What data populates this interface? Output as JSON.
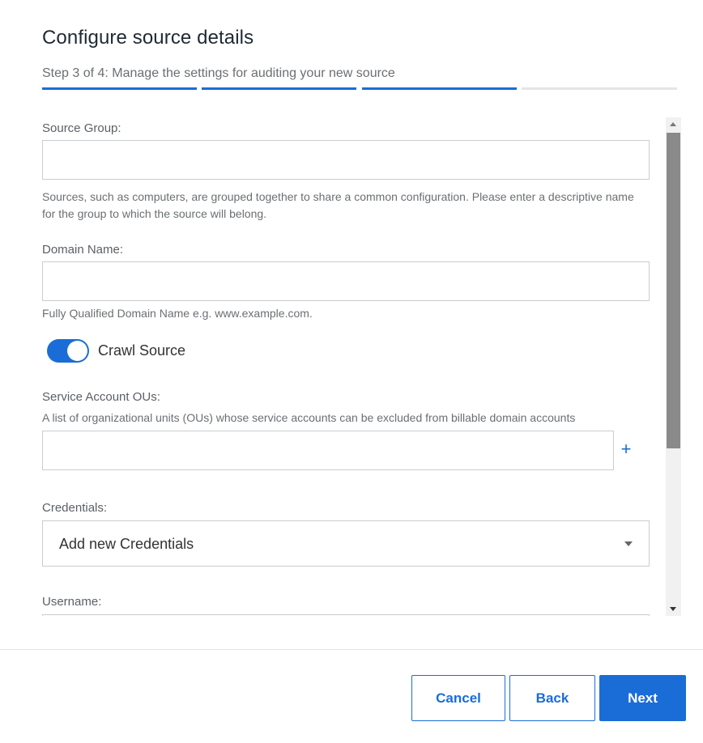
{
  "header": {
    "title": "Configure source details",
    "subtitle": "Step 3 of 4: Manage the settings for auditing your new source",
    "steps_total": 4,
    "steps_completed": 3
  },
  "form": {
    "source_group": {
      "label": "Source Group:",
      "value": "",
      "help": "Sources, such as computers, are grouped together to share a common configuration. Please enter a descriptive name for the group to which the source will belong."
    },
    "domain_name": {
      "label": "Domain Name:",
      "value": "",
      "help": "Fully Qualified Domain Name e.g. www.example.com."
    },
    "crawl_source": {
      "label": "Crawl Source",
      "enabled": true
    },
    "service_account_ous": {
      "label": "Service Account OUs:",
      "help": "A list of organizational units (OUs) whose service accounts can be excluded from billable domain accounts",
      "value": "",
      "add_icon": "plus-icon"
    },
    "credentials": {
      "label": "Credentials:",
      "selected": "Add new Credentials"
    },
    "username": {
      "label": "Username:",
      "value": ""
    }
  },
  "footer": {
    "cancel_label": "Cancel",
    "back_label": "Back",
    "next_label": "Next"
  },
  "colors": {
    "accent": "#1a6dd6",
    "step_inactive": "#e3e5e8",
    "scroll_thumb": "#8a8a8a"
  }
}
